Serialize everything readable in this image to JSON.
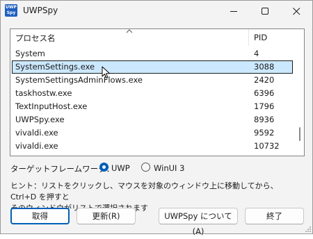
{
  "window": {
    "title": "UWPSpy",
    "icon_text_top": "UWP",
    "icon_text_bottom": "Spy",
    "accent": "#005fb8"
  },
  "listview": {
    "columns": {
      "name": "プロセス名",
      "pid": "PID"
    },
    "rows": [
      {
        "name": "System",
        "pid": "4"
      },
      {
        "name": "SystemSettings.exe",
        "pid": "3088",
        "selected": true
      },
      {
        "name": "SystemSettingsAdminFlows.exe",
        "pid": "2420"
      },
      {
        "name": "taskhostw.exe",
        "pid": "6396"
      },
      {
        "name": "TextInputHost.exe",
        "pid": "1796"
      },
      {
        "name": "UWPSpy.exe",
        "pid": "8936"
      },
      {
        "name": "vivaldi.exe",
        "pid": "9592"
      },
      {
        "name": "vivaldi.exe",
        "pid": "10732"
      }
    ]
  },
  "framework": {
    "label": "ターゲットフレームワーク：",
    "options": [
      {
        "label": "UWP",
        "selected": true
      },
      {
        "label": "WinUI 3",
        "selected": false
      }
    ]
  },
  "hint": {
    "line1": "ヒント：リストをクリックし、マウスを対象のウィンドウ上に移動してから、Ctrl+D を押すと",
    "line2": "そのウィンドウがリストで選択されます"
  },
  "buttons": {
    "get": "取得",
    "refresh": "更新(R)",
    "about": "UWPSpy について(A)",
    "exit": "終了"
  }
}
